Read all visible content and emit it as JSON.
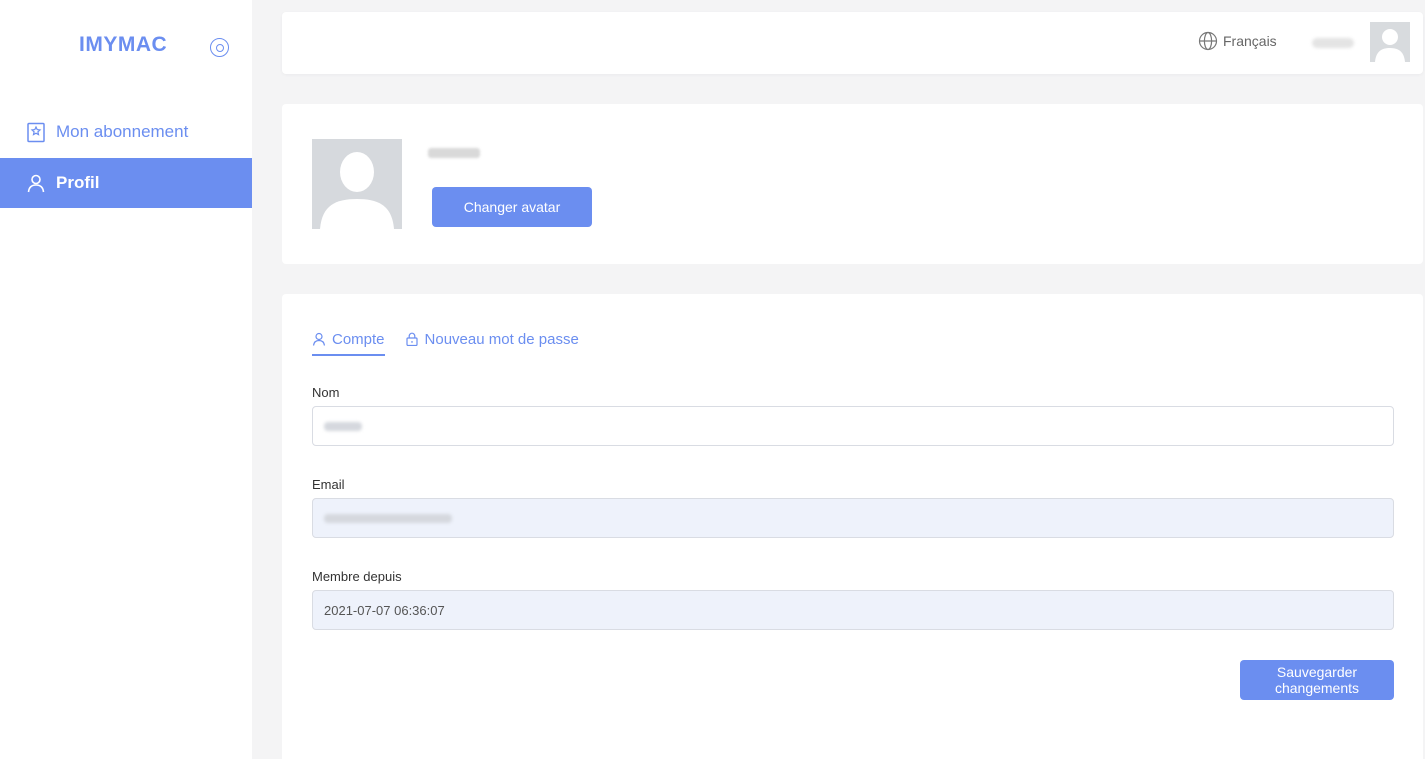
{
  "brand": {
    "logo_text": "IMYMAC",
    "accent_color": "#6b8ef0"
  },
  "sidebar": {
    "items": [
      {
        "label": "Mon abonnement",
        "icon": "bookmark-star-icon",
        "active": false
      },
      {
        "label": "Profil",
        "icon": "user-icon",
        "active": true
      }
    ]
  },
  "header": {
    "language_label": "Français",
    "language_icon": "globe-icon"
  },
  "profile": {
    "change_avatar_label": "Changer avatar"
  },
  "tabs": [
    {
      "label": "Compte",
      "icon": "user-icon",
      "active": true
    },
    {
      "label": "Nouveau mot de passe",
      "icon": "lock-icon",
      "active": false
    }
  ],
  "form": {
    "name_label": "Nom",
    "email_label": "Email",
    "member_since_label": "Membre depuis",
    "member_since_value": "2021-07-07 06:36:07",
    "save_label": "Sauvegarder changements"
  }
}
